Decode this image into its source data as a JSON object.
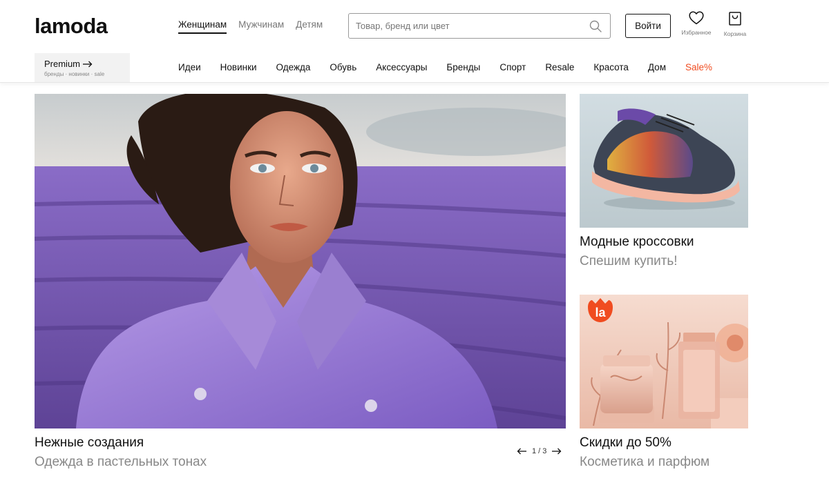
{
  "header": {
    "logo_text": "lamoda",
    "gender_tabs": [
      {
        "label": "Женщинам",
        "active": true
      },
      {
        "label": "Мужчинам",
        "active": false
      },
      {
        "label": "Детям",
        "active": false
      }
    ],
    "search": {
      "placeholder": "Товар, бренд или цвет",
      "value": ""
    },
    "login_label": "Войти",
    "favorites_label": "Избранное",
    "cart_label": "Корзина"
  },
  "premium": {
    "title": "Premium",
    "subtitle": "бренды · новинки · sale"
  },
  "categories": [
    "Идеи",
    "Новинки",
    "Одежда",
    "Обувь",
    "Аксессуары",
    "Бренды",
    "Спорт",
    "Resale",
    "Красота",
    "Дом",
    "Sale%"
  ],
  "hero": {
    "title": "Нежные создания",
    "subtitle": "Одежда в пастельных тонах",
    "pager": "1 / 3"
  },
  "cards": [
    {
      "title": "Модные кроссовки",
      "subtitle": "Спешим купить!"
    },
    {
      "title": "Скидки до 50%",
      "subtitle": "Косметика и парфюм",
      "badge": "la"
    }
  ],
  "colors": {
    "accent_sale": "#f04c20",
    "text_muted": "#888888",
    "lavender": "#7a5bbd",
    "badge": "#f04c20"
  }
}
